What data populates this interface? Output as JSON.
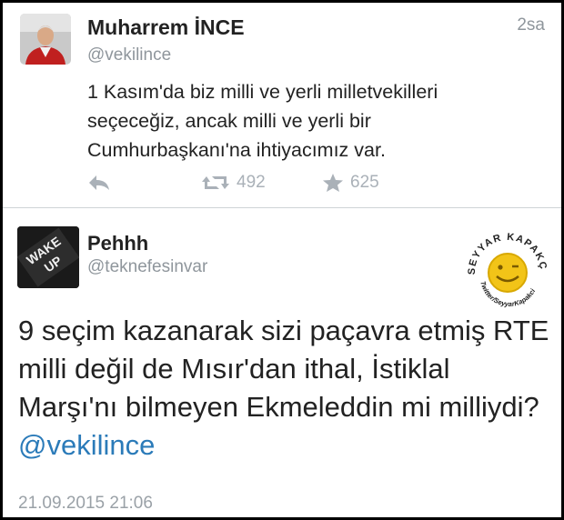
{
  "tweet1": {
    "name": "Muharrem İNCE",
    "handle": "@vekilince",
    "time": "2sa",
    "text": "1 Kasım'da biz milli ve yerli milletvekilleri\nseçeceğiz, ancak milli ve yerli bir\nCumhurbaşkanı'na ihtiyacımız var.",
    "retweets": "492",
    "favorites": "625",
    "icons": {
      "reply": "reply-icon",
      "retweet": "retweet-icon",
      "favorite": "star-icon"
    }
  },
  "tweet2": {
    "name": "Pehhh",
    "handle": "@teknefesinvar",
    "text_prefix": "9 seçim kazanarak sizi paçavra etmiş RTE milli değil de Mısır'dan ithal, İstiklal Marşı'nı bilmeyen Ekmeleddin mi milliydi? ",
    "mention": "@vekilince",
    "date": "21.09.2015 21:06",
    "avatar_text": {
      "line1": "WAKE",
      "line2": "UP"
    }
  },
  "watermark": {
    "arc_text": "SEYYAR KAPAKÇI",
    "bottom_text": "Twitter/SeyyarKapakci"
  },
  "colors": {
    "link": "#2b7bb9",
    "text": "#222222",
    "muted": "#8f969c",
    "watermark": "#e8c020"
  }
}
